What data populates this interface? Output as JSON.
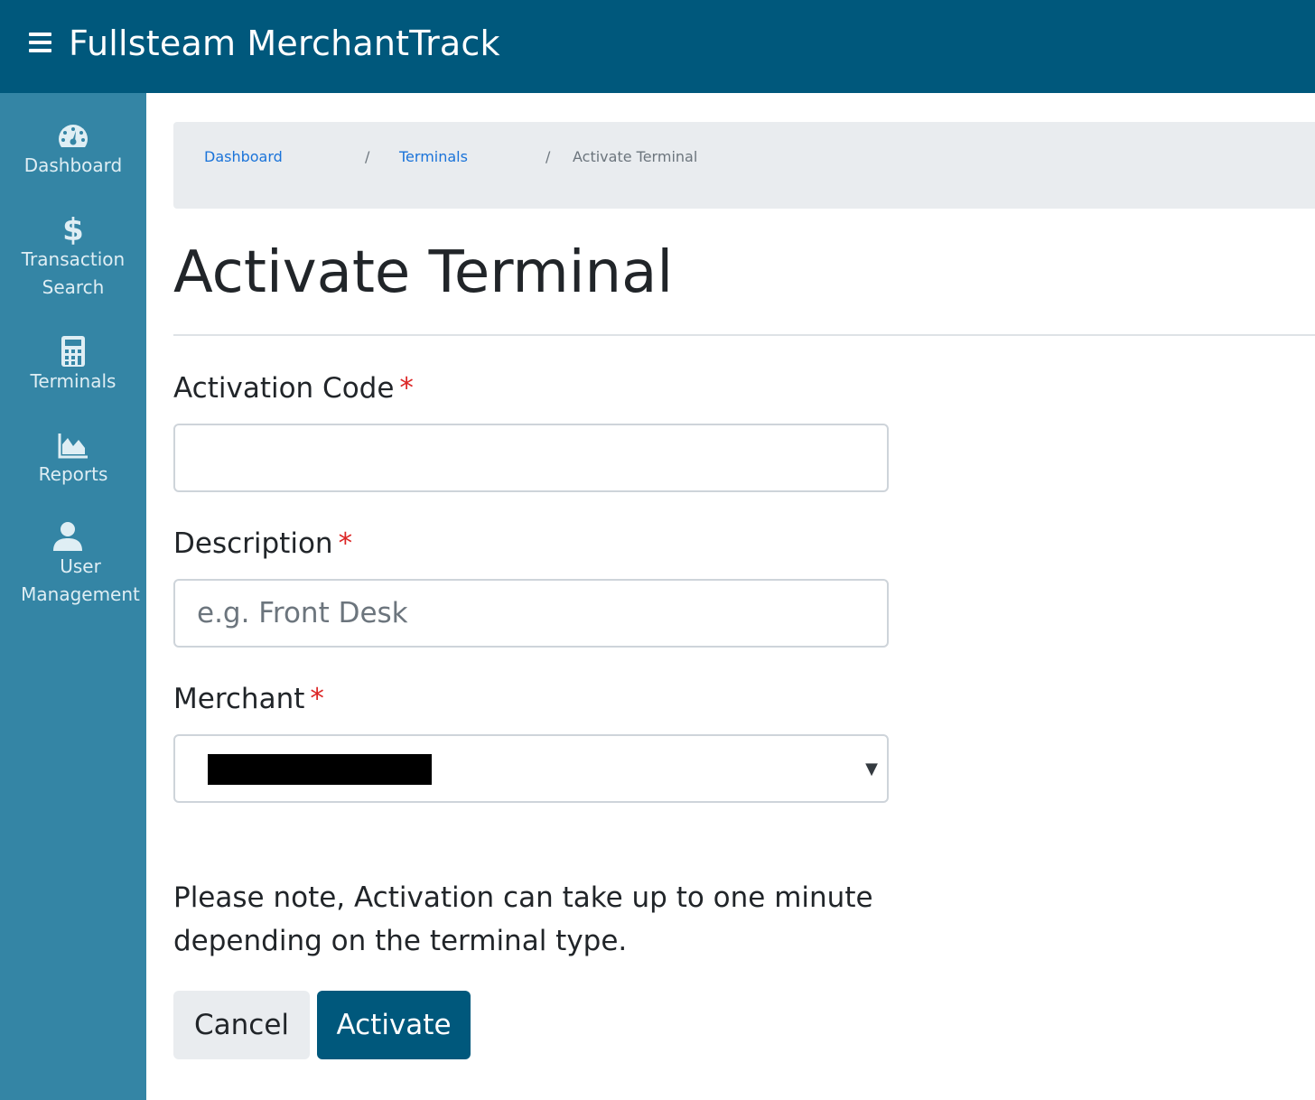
{
  "header": {
    "app_title": "Fullsteam MerchantTrack",
    "menu_icon": "hamburger-menu-icon",
    "background_color": "#00587c"
  },
  "sidebar": {
    "background_color": "#3485a5",
    "items": [
      {
        "label": "Dashboard",
        "icon": "speedometer-icon"
      },
      {
        "label": "Transaction\nSearch",
        "icon": "dollar-icon"
      },
      {
        "label": "Terminals",
        "icon": "calculator-icon"
      },
      {
        "label": "Reports",
        "icon": "area-chart-icon"
      },
      {
        "label": "User\nManagement",
        "icon": "user-icon"
      }
    ]
  },
  "breadcrumb": {
    "items": [
      {
        "label": "Dashboard",
        "link": true
      },
      {
        "label": "Terminals",
        "link": true
      },
      {
        "label": "Activate Terminal",
        "link": false
      }
    ],
    "separator": "/"
  },
  "page": {
    "title": "Activate Terminal"
  },
  "form": {
    "activation_code": {
      "label": "Activation Code",
      "required_mark": "*",
      "value": "",
      "placeholder": ""
    },
    "description": {
      "label": "Description",
      "required_mark": "*",
      "value": "",
      "placeholder": "e.g. Front Desk"
    },
    "merchant": {
      "label": "Merchant",
      "required_mark": "*",
      "selected_value_redacted": true,
      "arrow_icon": "caret-down-icon"
    },
    "note": "Please note, Activation can take up to one minute depending on the terminal type."
  },
  "buttons": {
    "cancel_label": "Cancel",
    "activate_label": "Activate"
  },
  "colors": {
    "link": "#1a73d9",
    "required": "#dc2626",
    "primary_button": "#00587c"
  }
}
